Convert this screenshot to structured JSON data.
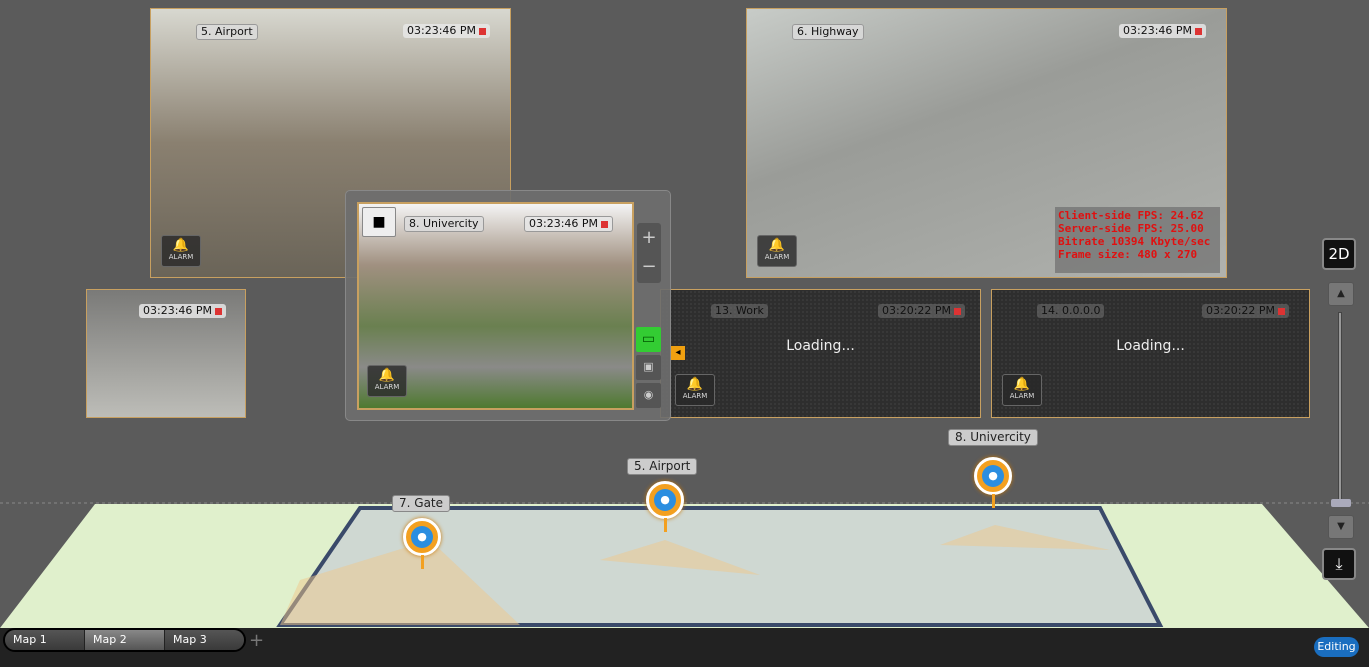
{
  "cameras": {
    "airport": {
      "name": "5. Airport",
      "time": "03:23:46 PM",
      "alarm": "ALARM"
    },
    "highway": {
      "name": "6. Highway",
      "time": "03:23:46 PM",
      "alarm": "ALARM",
      "stats": [
        "Client-side FPS: 24.62",
        "Server-side FPS: 25.00",
        "Bitrate 10394 Kbyte/sec",
        "Frame size: 480 x 270"
      ]
    },
    "gate": {
      "time": "03:23:46 PM"
    },
    "univercity": {
      "name": "8. Univercity",
      "time": "03:23:46 PM",
      "alarm": "ALARM"
    },
    "work": {
      "name": "13. Work",
      "time": "03:20:22 PM",
      "status": "Loading...",
      "alarm": "ALARM"
    },
    "ip": {
      "name": "14. 0.0.0.0",
      "time": "03:20:22 PM",
      "status": "Loading...",
      "alarm": "ALARM"
    }
  },
  "map_labels": {
    "univercity": "8. Univercity",
    "airport": "5. Airport",
    "gate": "7. Gate"
  },
  "controls": {
    "zoom_in": "+",
    "zoom_out": "−",
    "view_2d": "2D"
  },
  "tabs": [
    "Map 1",
    "Map 2",
    "Map 3"
  ],
  "add_tab": "+",
  "status": "Editing"
}
